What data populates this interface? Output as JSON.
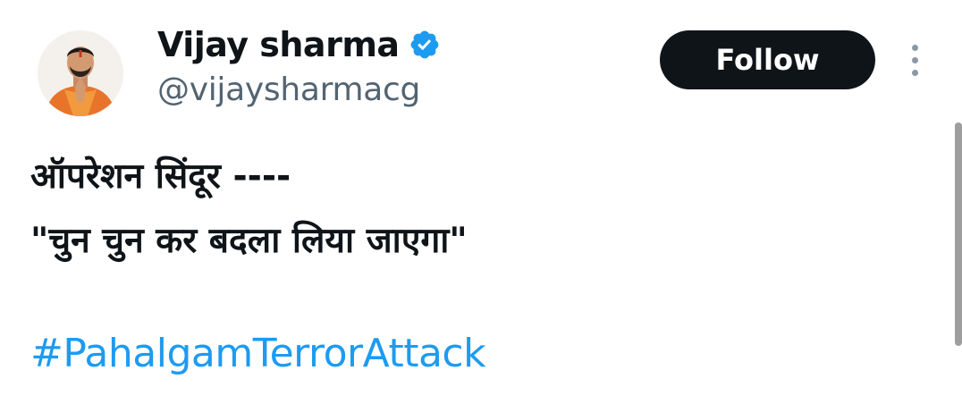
{
  "author": {
    "display_name": "Vijay sharma",
    "handle": "@vijaysharmacg",
    "verified": true,
    "avatar_icon": "profile-photo"
  },
  "actions": {
    "follow_label": "Follow",
    "more_icon": "more-vertical-icon"
  },
  "tweet": {
    "line1": "ऑपरेशन सिंदूर ----",
    "line2": "\"चुन चुन कर बदला लिया जाएगा\"",
    "hashtag": "#PahalgamTerrorAttack"
  },
  "colors": {
    "text": "#0f1419",
    "secondary": "#536471",
    "link": "#1d9bf0",
    "button_bg": "#0f1419",
    "verified_badge": "#1d9bf0"
  }
}
